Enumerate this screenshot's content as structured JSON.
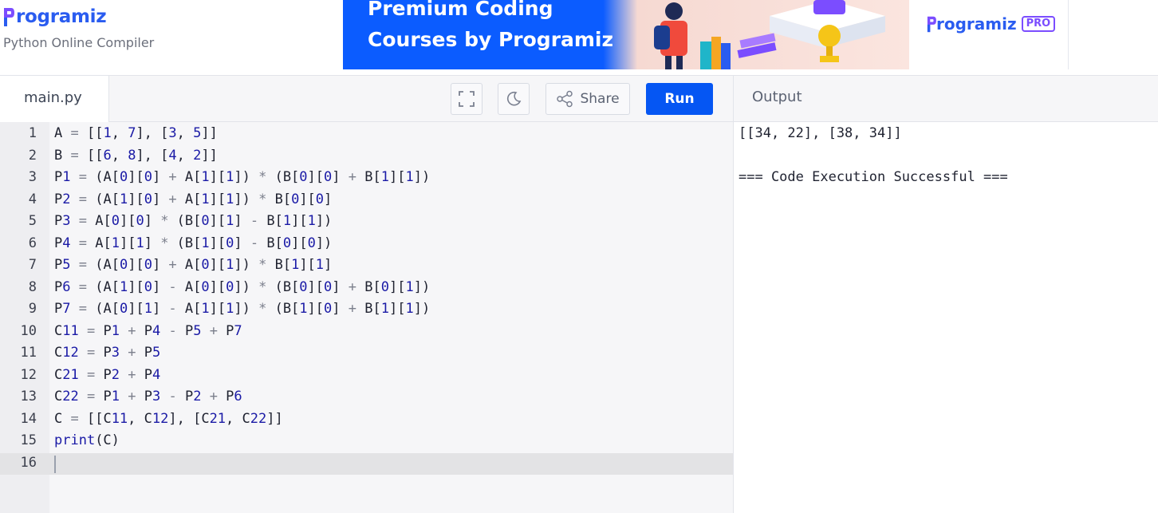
{
  "header": {
    "logo_text": "rogramiz",
    "subtitle": "Python Online Compiler",
    "banner_line1": "Premium Coding",
    "banner_line2": "Courses by Programiz",
    "banner_logo_text": "rogramiz",
    "banner_badge": "PRO"
  },
  "toolbar": {
    "file_tab": "main.py",
    "fullscreen_icon": "fullscreen-icon",
    "theme_icon": "moon-icon",
    "share_label": "Share",
    "run_label": "Run",
    "output_label": "Output"
  },
  "editor": {
    "active_line": 16,
    "lines": [
      "A = [[1, 7], [3, 5]]",
      "B = [[6, 8], [4, 2]]",
      "P1 = (A[0][0] + A[1][1]) * (B[0][0] + B[1][1])",
      "P2 = (A[1][0] + A[1][1]) * B[0][0]",
      "P3 = A[0][0] * (B[0][1] - B[1][1])",
      "P4 = A[1][1] * (B[1][0] - B[0][0])",
      "P5 = (A[0][0] + A[0][1]) * B[1][1]",
      "P6 = (A[1][0] - A[0][0]) * (B[0][0] + B[0][1])",
      "P7 = (A[0][1] - A[1][1]) * (B[1][0] + B[1][1])",
      "C11 = P1 + P4 - P5 + P7",
      "C12 = P3 + P5",
      "C21 = P2 + P4",
      "C22 = P1 + P3 - P2 + P6",
      "C = [[C11, C12], [C21, C22]]",
      "print(C)",
      ""
    ]
  },
  "output": {
    "lines": [
      "[[34, 22], [38, 34]]",
      "",
      "=== Code Execution Successful ==="
    ]
  },
  "colors": {
    "brand_blue": "#2a5cf0",
    "run_button": "#0556f3",
    "number_token": "#1a1aa6",
    "editor_bg": "#f6f6f8"
  }
}
